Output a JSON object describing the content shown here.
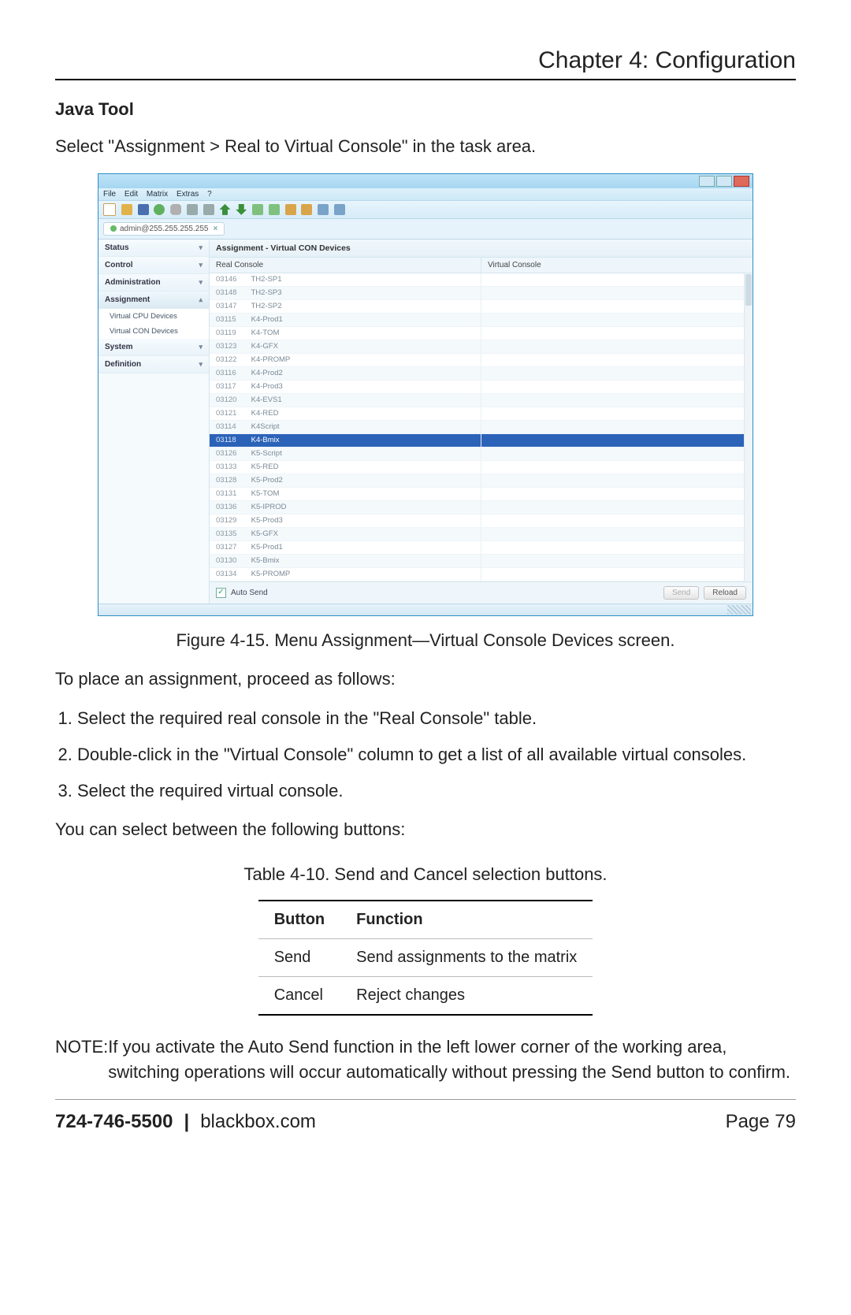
{
  "chapter_title": "Chapter 4: Configuration",
  "section_title": "Java Tool",
  "intro_text": "Select \"Assignment > Real to Virtual Console\" in the task area.",
  "figure_caption": "Figure 4-15. Menu Assignment—Virtual Console Devices screen.",
  "proc_intro": "To place an assignment, proceed as follows:",
  "steps": [
    "Select the required real console in the \"Real Console\" table.",
    "Double-click in the \"Virtual Console\" column to get a list of all available virtual consoles.",
    "Select the required virtual console."
  ],
  "buttons_intro": "You can select between the following buttons:",
  "table_title": "Table 4-10. Send and Cancel selection buttons.",
  "table_header": {
    "c1": "Button",
    "c2": "Function"
  },
  "table_rows": [
    {
      "c1": "Send",
      "c2": "Send assignments to the matrix"
    },
    {
      "c1": "Cancel",
      "c2": "Reject changes"
    }
  ],
  "note_label": "NOTE:",
  "note_body": "If you activate the Auto Send function in the left lower corner of the working area, switching operations will occur automatically without pressing the Send button to confirm.",
  "footer": {
    "phone": "724-746-5500",
    "site": "blackbox.com",
    "page": "Page 79"
  },
  "app": {
    "menubar": {
      "file": "File",
      "edit": "Edit",
      "matrix": "Matrix",
      "extras": "Extras",
      "help": "?"
    },
    "tab_label": "admin@255.255.255.255",
    "sidebar": {
      "status": "Status",
      "control": "Control",
      "administration": "Administration",
      "assignment": "Assignment",
      "sub1": "Virtual CPU Devices",
      "sub2": "Virtual CON Devices",
      "system": "System",
      "definition": "Definition"
    },
    "content_title": "Assignment - Virtual CON Devices",
    "col_real": "Real Console",
    "col_virtual": "Virtual Console",
    "rows": [
      {
        "id": "03146",
        "name": "TH2-SP1"
      },
      {
        "id": "03148",
        "name": "TH2-SP3"
      },
      {
        "id": "03147",
        "name": "TH2-SP2"
      },
      {
        "id": "03115",
        "name": "K4-Prod1"
      },
      {
        "id": "03119",
        "name": "K4-TOM"
      },
      {
        "id": "03123",
        "name": "K4-GFX"
      },
      {
        "id": "03122",
        "name": "K4-PROMP"
      },
      {
        "id": "03116",
        "name": "K4-Prod2"
      },
      {
        "id": "03117",
        "name": "K4-Prod3"
      },
      {
        "id": "03120",
        "name": "K4-EVS1"
      },
      {
        "id": "03121",
        "name": "K4-RED"
      },
      {
        "id": "03114",
        "name": "K4Script"
      },
      {
        "id": "03118",
        "name": "K4-Bmix",
        "selected": true
      },
      {
        "id": "03126",
        "name": "K5-Script"
      },
      {
        "id": "03133",
        "name": "K5-RED"
      },
      {
        "id": "03128",
        "name": "K5-Prod2"
      },
      {
        "id": "03131",
        "name": "K5-TOM"
      },
      {
        "id": "03136",
        "name": "K5-IPROD"
      },
      {
        "id": "03129",
        "name": "K5-Prod3"
      },
      {
        "id": "03135",
        "name": "K5-GFX"
      },
      {
        "id": "03127",
        "name": "K5-Prod1"
      },
      {
        "id": "03130",
        "name": "K5-Bmix"
      },
      {
        "id": "03134",
        "name": "K5-PROMP"
      }
    ],
    "auto_send": "Auto Send",
    "btn_send": "Send",
    "btn_reload": "Reload"
  }
}
